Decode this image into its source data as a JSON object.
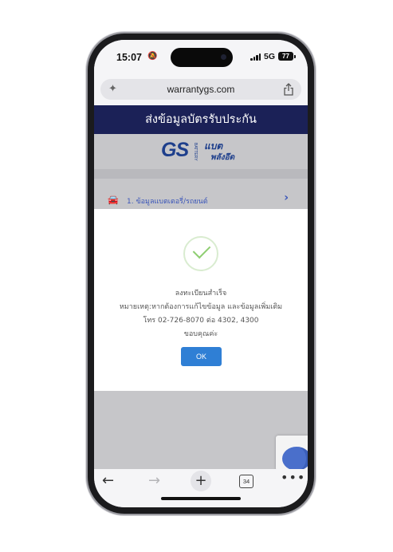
{
  "status_bar": {
    "time": "15:07",
    "network": "5G",
    "battery": "77"
  },
  "browser": {
    "url": "warrantygs.com",
    "tab_count": "34"
  },
  "page": {
    "title": "ส่งข้อมูลบัตรรับประกัน",
    "logo_text": "GS",
    "logo_subtext": "BATTERY",
    "brand_text": "แบต พลังอึด",
    "section_label": "1. ข้อมูลแบตเตอรี่/รถยนต์"
  },
  "modal": {
    "title": "ลงทะเบียนสำเร็จ",
    "note": "หมายเหตุ:หากต้องการแก้ไขข้อมูล และข้อมูลเพิ่มเติม",
    "phone": "โทร 02-726-8070 ต่อ 4302, 4300",
    "thanks": "ขอบคุณค่ะ",
    "ok_label": "OK"
  },
  "colors": {
    "header_bg": "#1b2157",
    "accent": "#2f7fd5",
    "success": "#8fce72"
  },
  "icons": [
    "sparkle-icon",
    "share-icon",
    "car-icon",
    "chevron-right-icon",
    "check-icon",
    "back-arrow-icon",
    "forward-arrow-icon",
    "plus-icon",
    "tabs-icon",
    "more-icon"
  ]
}
